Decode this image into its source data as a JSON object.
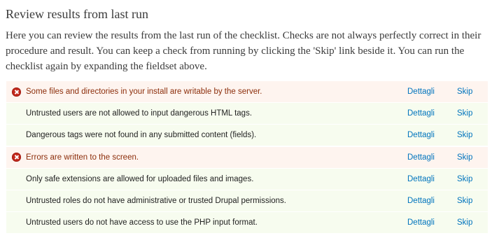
{
  "header": {
    "title": "Review results from last run",
    "description": "Here you can review the results from the last run of the checklist. Checks are not always perfectly correct in their procedure and result. You can keep a check from running by clicking the 'Skip' link beside it. You can run the checklist again by expanding the fieldset above."
  },
  "results": [
    {
      "status": "fail",
      "message": "Some files and directories in your install are writable by the server.",
      "details_label": "Dettagli",
      "skip_label": "Skip"
    },
    {
      "status": "pass",
      "message": "Untrusted users are not allowed to input dangerous HTML tags.",
      "details_label": "Dettagli",
      "skip_label": "Skip"
    },
    {
      "status": "pass",
      "message": "Dangerous tags were not found in any submitted content (fields).",
      "details_label": "Dettagli",
      "skip_label": "Skip"
    },
    {
      "status": "fail",
      "message": "Errors are written to the screen.",
      "details_label": "Dettagli",
      "skip_label": "Skip"
    },
    {
      "status": "pass",
      "message": "Only safe extensions are allowed for uploaded files and images.",
      "details_label": "Dettagli",
      "skip_label": "Skip"
    },
    {
      "status": "pass",
      "message": "Untrusted roles do not have administrative or trusted Drupal permissions.",
      "details_label": "Dettagli",
      "skip_label": "Skip"
    },
    {
      "status": "pass",
      "message": "Untrusted users do not have access to use the PHP input format.",
      "details_label": "Dettagli",
      "skip_label": "Skip"
    }
  ],
  "colors": {
    "pass_row_bg": "#f7fcef",
    "fail_row_bg": "#fef4ef",
    "fail_text": "#8c2e0b",
    "link": "#0074bd",
    "error_icon": "#c3281c"
  },
  "icons": {
    "fail": "error-icon"
  }
}
